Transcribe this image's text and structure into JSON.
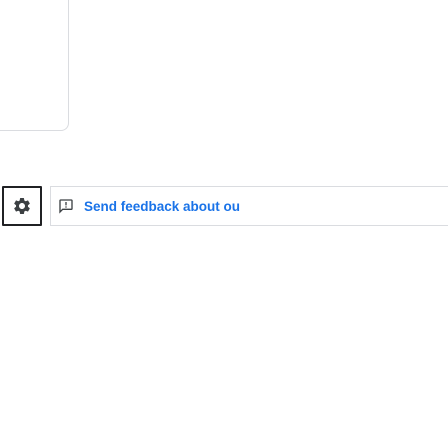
{
  "feedback": {
    "settings_icon": "settings-icon",
    "link_icon": "feedback-icon",
    "link_label": "Send feedback about ou"
  },
  "colors": {
    "link": "#1a73e8",
    "divider": "#dadce0",
    "icon": "#3c4043"
  }
}
